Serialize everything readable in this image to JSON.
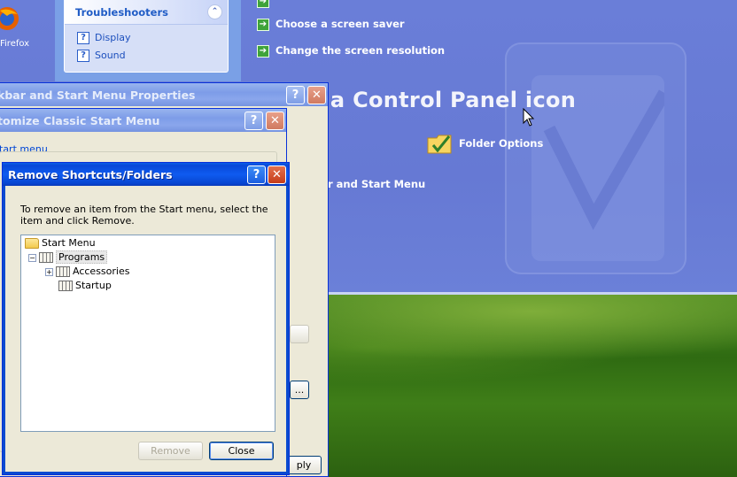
{
  "desktop": {
    "firefox_label": "Firefox"
  },
  "control_panel": {
    "troubleshooters": {
      "title": "Troubleshooters",
      "links": [
        "Display",
        "Sound"
      ]
    },
    "tasks": [
      "Choose a screen saver",
      "Change the screen resolution"
    ],
    "pick_heading": "k a Control Panel icon",
    "folder_options": "Folder Options",
    "taskbar_link": "r and Start Menu"
  },
  "windows": {
    "taskbar_props": {
      "title": "kbar and Start Menu Properties",
      "apply_label": "ply",
      "ellipsis_btn": "..."
    },
    "customize": {
      "title": "tomize Classic Start Menu",
      "group_label": "tart menu"
    },
    "remove": {
      "title": "Remove Shortcuts/Folders",
      "instructions": "To remove an item from the Start menu, select the item and click Remove.",
      "tree": {
        "root": "Start Menu",
        "programs": "Programs",
        "accessories": "Accessories",
        "startup": "Startup"
      },
      "remove_label": "Remove",
      "close_label": "Close"
    }
  },
  "icons": {
    "help": "?",
    "close": "✕",
    "collapse": "⌃"
  }
}
